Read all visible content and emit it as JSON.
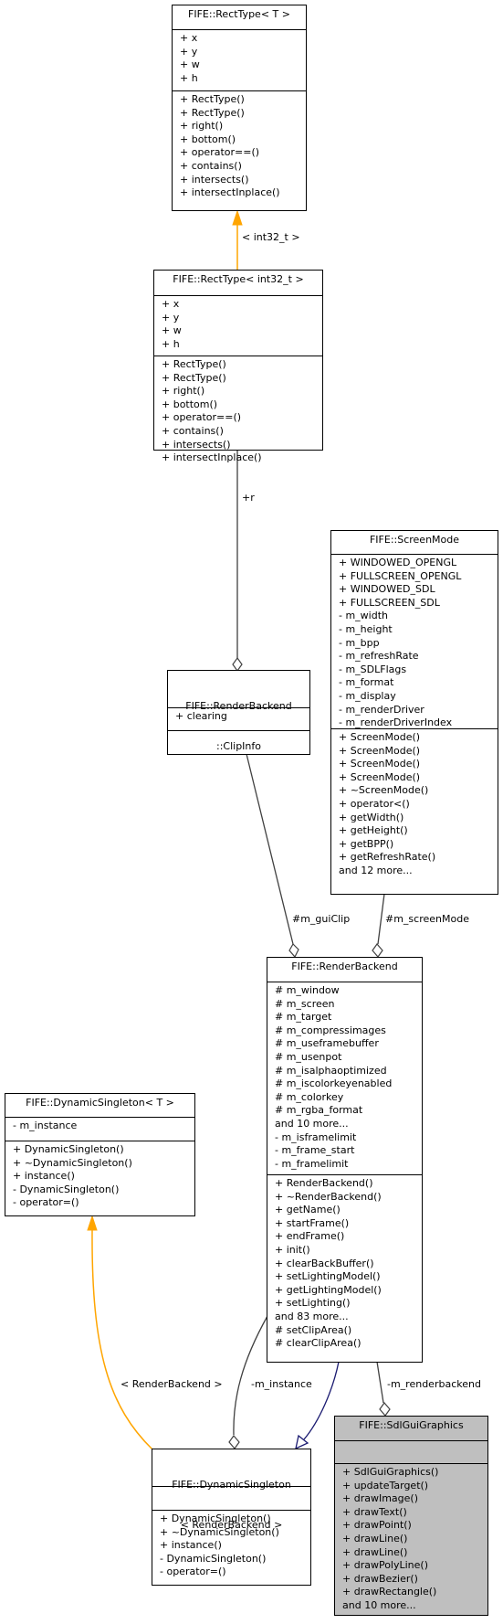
{
  "diagram": {
    "nodes": {
      "rect_t": {
        "title": "FIFE::RectType< T >",
        "attributes": [
          "+ x",
          "+ y",
          "+ w",
          "+ h"
        ],
        "methods": [
          "+ RectType()",
          "+ RectType()",
          "+ right()",
          "+ bottom()",
          "+ operator==()",
          "+ contains()",
          "+ intersects()",
          "+ intersectInplace()"
        ]
      },
      "rect_int32": {
        "title": "FIFE::RectType< int32_t >",
        "attributes": [
          "+ x",
          "+ y",
          "+ w",
          "+ h"
        ],
        "methods": [
          "+ RectType()",
          "+ RectType()",
          "+ right()",
          "+ bottom()",
          "+ operator==()",
          "+ contains()",
          "+ intersects()",
          "+ intersectInplace()"
        ]
      },
      "clipinfo": {
        "title_line1": "FIFE::RenderBackend",
        "title_line2": "::ClipInfo",
        "attributes": [
          "+ clearing"
        ],
        "methods": []
      },
      "screenmode": {
        "title": "FIFE::ScreenMode",
        "attributes": [
          "+ WINDOWED_OPENGL",
          "+ FULLSCREEN_OPENGL",
          "+ WINDOWED_SDL",
          "+ FULLSCREEN_SDL",
          "- m_width",
          "- m_height",
          "- m_bpp",
          "- m_refreshRate",
          "- m_SDLFlags",
          "- m_format",
          "- m_display",
          "- m_renderDriver",
          "- m_renderDriverIndex"
        ],
        "methods": [
          "+ ScreenMode()",
          "+ ScreenMode()",
          "+ ScreenMode()",
          "+ ScreenMode()",
          "+ ~ScreenMode()",
          "+ operator<()",
          "+ getWidth()",
          "+ getHeight()",
          "+ getBPP()",
          "+ getRefreshRate()",
          "and 12 more..."
        ]
      },
      "renderbackend": {
        "title": "FIFE::RenderBackend",
        "attributes": [
          "# m_window",
          "# m_screen",
          "# m_target",
          "# m_compressimages",
          "# m_useframebuffer",
          "# m_usenpot",
          "# m_isalphaoptimized",
          "# m_iscolorkeyenabled",
          "# m_colorkey",
          "# m_rgba_format",
          "and 10 more...",
          "- m_isframelimit",
          "- m_frame_start",
          "- m_framelimit"
        ],
        "methods": [
          "+ RenderBackend()",
          "+ ~RenderBackend()",
          "+ getName()",
          "+ startFrame()",
          "+ endFrame()",
          "+ init()",
          "+ clearBackBuffer()",
          "+ setLightingModel()",
          "+ getLightingModel()",
          "+ setLighting()",
          "and 83 more...",
          "# setClipArea()",
          "# clearClipArea()"
        ]
      },
      "dynsingleton_t": {
        "title": "FIFE::DynamicSingleton< T >",
        "attributes": [
          "- m_instance"
        ],
        "methods": [
          "+ DynamicSingleton()",
          "+ ~DynamicSingleton()",
          "+ instance()",
          "- DynamicSingleton()",
          "- operator=()"
        ]
      },
      "dynsingleton_rb": {
        "title_line1": "FIFE::DynamicSingleton",
        "title_line2": "< RenderBackend >",
        "attributes": [],
        "methods": [
          "+ DynamicSingleton()",
          "+ ~DynamicSingleton()",
          "+ instance()",
          "- DynamicSingleton()",
          "- operator=()"
        ]
      },
      "sdlguigraphics": {
        "title": "FIFE::SdlGuiGraphics",
        "attributes": [],
        "methods": [
          "+ SdlGuiGraphics()",
          "+ updateTarget()",
          "+ drawImage()",
          "+ drawText()",
          "+ drawPoint()",
          "+ drawLine()",
          "+ drawLine()",
          "+ drawPolyLine()",
          "+ drawBezier()",
          "+ drawRectangle()",
          "and 10 more..."
        ]
      }
    },
    "edge_labels": {
      "int32_template": "< int32_t >",
      "r": "+r",
      "gui_clip": "#m_guiClip",
      "screen_mode": "#m_screenMode",
      "renderbackend_template": "< RenderBackend >",
      "instance": "-m_instance",
      "renderbackend_member": "-m_renderbackend"
    },
    "colors": {
      "template_edge": "#ffa500",
      "inheritance_edge": "#191970",
      "usage_edge": "#404040",
      "highlight_fill": "#bfbfbf"
    }
  }
}
